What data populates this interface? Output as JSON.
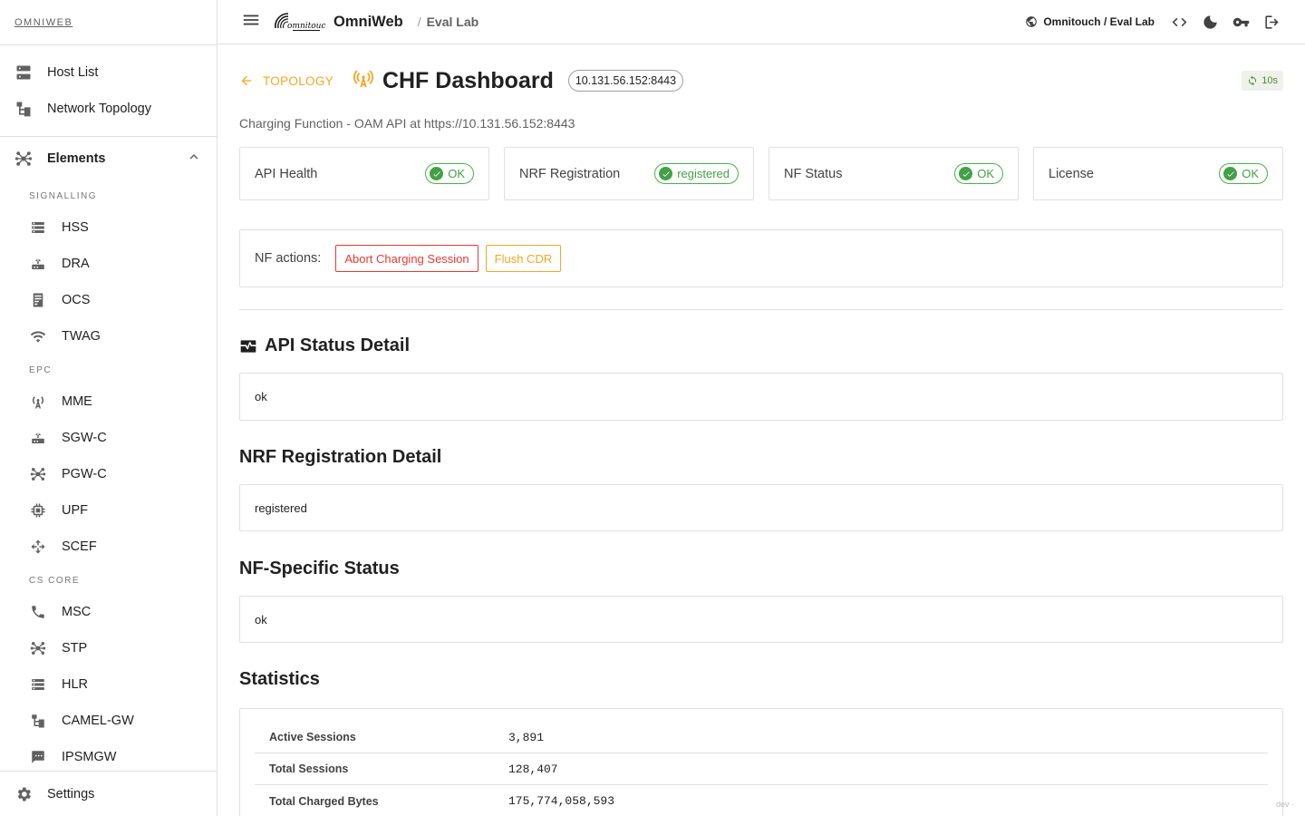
{
  "brand": "OMNIWEB",
  "topbar": {
    "app_name": "OmniWeb",
    "crumb_sep": "/",
    "crumb": "Eval Lab",
    "tenant": "Omnitouch / Eval Lab"
  },
  "nav": {
    "host_list": "Host List",
    "network_topology": "Network Topology",
    "elements": "Elements",
    "groups": {
      "signalling": "SIGNALLING",
      "epc": "EPC",
      "cs_core": "CS CORE"
    },
    "signalling_items": [
      "HSS",
      "DRA",
      "OCS",
      "TWAG"
    ],
    "epc_items": [
      "MME",
      "SGW-C",
      "PGW-C",
      "UPF",
      "SCEF"
    ],
    "cs_items": [
      "MSC",
      "STP",
      "HLR",
      "CAMEL-GW",
      "IPSMGW"
    ],
    "settings": "Settings"
  },
  "page": {
    "back_label": "TOPOLOGY",
    "title": "CHF Dashboard",
    "address": "10.131.56.152:8443",
    "refresh": "10s",
    "subtitle": "Charging Function - OAM API at https://10.131.56.152:8443"
  },
  "status_cards": [
    {
      "label": "API Health",
      "value": "OK"
    },
    {
      "label": "NRF Registration",
      "value": "registered"
    },
    {
      "label": "NF Status",
      "value": "OK"
    },
    {
      "label": "License",
      "value": "OK"
    }
  ],
  "actions": {
    "label": "NF actions:",
    "abort": "Abort Charging Session",
    "flush": "Flush CDR"
  },
  "sections": {
    "api_status": {
      "title": "API Status Detail",
      "value": "ok"
    },
    "nrf_detail": {
      "title": "NRF Registration Detail",
      "value": "registered"
    },
    "nf_status": {
      "title": "NF-Specific Status",
      "value": "ok"
    },
    "statistics": {
      "title": "Statistics"
    }
  },
  "stats": [
    {
      "key": "Active Sessions",
      "value": "3,891"
    },
    {
      "key": "Total Sessions",
      "value": "128,407"
    },
    {
      "key": "Total Charged Bytes",
      "value": "175,774,058,593"
    }
  ],
  "footer": {
    "dev": "dev ·"
  },
  "colors": {
    "accent": "#f5a623",
    "ok": "#43a047",
    "danger": "#e53935"
  }
}
